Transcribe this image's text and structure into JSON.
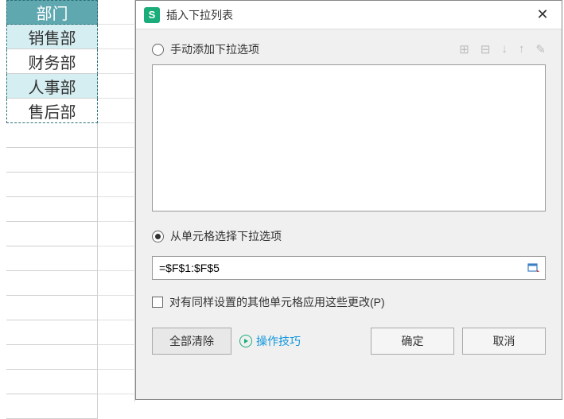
{
  "sheet": {
    "header": "部门",
    "cells": [
      "销售部",
      "财务部",
      "人事部",
      "售后部"
    ]
  },
  "dialog": {
    "title": "插入下拉列表",
    "close": "✕",
    "option_manual": "手动添加下拉选项",
    "option_range": "从单元格选择下拉选项",
    "range_value": "=$F$1:$F$5",
    "apply_other": "对有同样设置的其他单元格应用这些更改(P)",
    "clear_all": "全部清除",
    "tips": "操作技巧",
    "ok": "确定",
    "cancel": "取消"
  },
  "icons": {
    "app": "S",
    "add": "⊞",
    "del": "⊟",
    "down": "↓",
    "up": "↑",
    "edit": "✎"
  }
}
